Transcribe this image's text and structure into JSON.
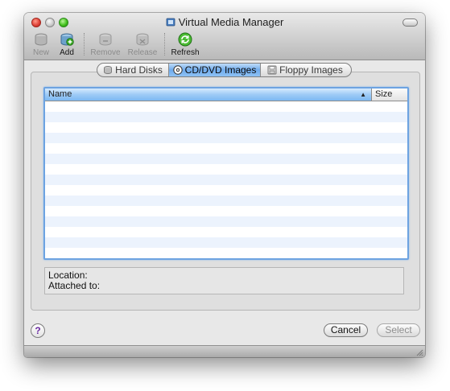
{
  "window": {
    "title": "Virtual Media Manager"
  },
  "toolbar": {
    "new_label": "New",
    "add_label": "Add",
    "remove_label": "Remove",
    "release_label": "Release",
    "refresh_label": "Refresh"
  },
  "tabs": [
    {
      "label": "Hard Disks",
      "icon": "hard-disk-icon",
      "active": false
    },
    {
      "label": "CD/DVD Images",
      "icon": "cd-dvd-icon",
      "active": true
    },
    {
      "label": "Floppy Images",
      "icon": "floppy-icon",
      "active": false
    }
  ],
  "table": {
    "columns": [
      {
        "label": "Name",
        "sort": "ascending"
      },
      {
        "label": "Size"
      }
    ],
    "rows": []
  },
  "info": {
    "location_label": "Location:",
    "attached_label": "Attached to:"
  },
  "buttons": {
    "help": "?",
    "cancel": "Cancel",
    "select": "Select"
  },
  "colors": {
    "selection_accent": "#6fabec",
    "table_border": "#6da3e1",
    "row_stripe": "#ecf3fd",
    "help_icon": "#6b2ca3"
  }
}
